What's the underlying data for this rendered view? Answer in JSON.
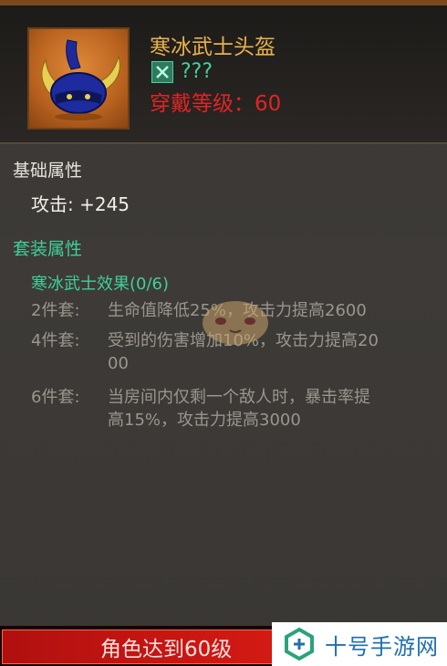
{
  "item": {
    "name": "寒冰武士头盔",
    "set_text": "???",
    "requirement": "穿戴等级：60"
  },
  "base_attributes": {
    "title": "基础属性",
    "attack": "攻击: +245"
  },
  "set_attributes": {
    "title": "套装属性",
    "set_name": "寒冰武士效果(0/6)",
    "bonuses": [
      {
        "label": "2件套:",
        "text": "生命值降低25%，攻击力提高2600",
        "cont": ""
      },
      {
        "label": "4件套:",
        "text": "受到的伤害增加10%，攻击力提高20",
        "cont": "00"
      },
      {
        "label": "6件套:",
        "text": "当房间内仅剩一个敌人时，暴击率提",
        "cont": "高15%，攻击力提高3000"
      }
    ]
  },
  "footer": {
    "requirement_banner": "角色达到60级",
    "brand_name": "十号手游网"
  },
  "colors": {
    "item_name": "#e8b24a",
    "set_green": "#3fcf9a",
    "requirement_red": "#e02424",
    "bonus_grey": "#9a958d"
  },
  "icons": {
    "item": "horned-helmet-icon",
    "set": "crossed-swords-icon",
    "brand": "brand-logo-icon"
  }
}
